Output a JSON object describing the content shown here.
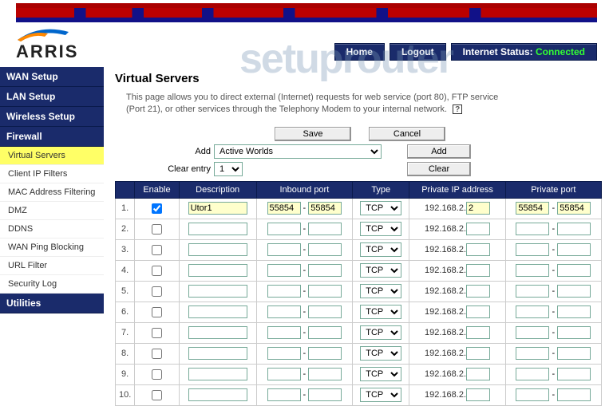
{
  "watermark": "setuprouter",
  "brand": "ARRIS",
  "nav": {
    "home": "Home",
    "logout": "Logout",
    "status_label": "Internet Status:",
    "status_value": "Connected"
  },
  "sidebar": {
    "sections": [
      {
        "title": "WAN Setup",
        "items": []
      },
      {
        "title": "LAN Setup",
        "items": []
      },
      {
        "title": "Wireless Setup",
        "items": []
      },
      {
        "title": "Firewall",
        "items": [
          "Virtual Servers",
          "Client IP Filters",
          "MAC Address Filtering",
          "DMZ",
          "DDNS",
          "WAN Ping Blocking",
          "URL Filter",
          "Security Log"
        ],
        "active_index": 0
      },
      {
        "title": "Utilities",
        "items": []
      }
    ]
  },
  "page": {
    "title": "Virtual Servers",
    "description": "This page allows you to direct external (Internet) requests for web service (port 80), FTP service (Port 21), or other services through the Telephony Modem to your internal network.",
    "help_icon": "?"
  },
  "controls": {
    "save": "Save",
    "cancel": "Cancel",
    "add_label": "Add",
    "add_select_value": "Active Worlds",
    "add_button": "Add",
    "clear_label": "Clear entry",
    "clear_select_value": "1",
    "clear_button": "Clear"
  },
  "table": {
    "headers": {
      "enable": "Enable",
      "description": "Description",
      "inbound": "Inbound port",
      "type": "Type",
      "private_ip": "Private IP address",
      "private_port": "Private port"
    },
    "ip_prefix": "192.168.2.",
    "type_option": "TCP",
    "rows": [
      {
        "n": "1.",
        "enabled": true,
        "desc": "Utor1",
        "in_from": "55854",
        "in_to": "55854",
        "ip": "2",
        "pp_from": "55854",
        "pp_to": "55854",
        "yellow": true
      },
      {
        "n": "2.",
        "enabled": false,
        "desc": "",
        "in_from": "",
        "in_to": "",
        "ip": "",
        "pp_from": "",
        "pp_to": "",
        "yellow": false
      },
      {
        "n": "3.",
        "enabled": false,
        "desc": "",
        "in_from": "",
        "in_to": "",
        "ip": "",
        "pp_from": "",
        "pp_to": "",
        "yellow": false
      },
      {
        "n": "4.",
        "enabled": false,
        "desc": "",
        "in_from": "",
        "in_to": "",
        "ip": "",
        "pp_from": "",
        "pp_to": "",
        "yellow": false
      },
      {
        "n": "5.",
        "enabled": false,
        "desc": "",
        "in_from": "",
        "in_to": "",
        "ip": "",
        "pp_from": "",
        "pp_to": "",
        "yellow": false
      },
      {
        "n": "6.",
        "enabled": false,
        "desc": "",
        "in_from": "",
        "in_to": "",
        "ip": "",
        "pp_from": "",
        "pp_to": "",
        "yellow": false
      },
      {
        "n": "7.",
        "enabled": false,
        "desc": "",
        "in_from": "",
        "in_to": "",
        "ip": "",
        "pp_from": "",
        "pp_to": "",
        "yellow": false
      },
      {
        "n": "8.",
        "enabled": false,
        "desc": "",
        "in_from": "",
        "in_to": "",
        "ip": "",
        "pp_from": "",
        "pp_to": "",
        "yellow": false
      },
      {
        "n": "9.",
        "enabled": false,
        "desc": "",
        "in_from": "",
        "in_to": "",
        "ip": "",
        "pp_from": "",
        "pp_to": "",
        "yellow": false
      },
      {
        "n": "10.",
        "enabled": false,
        "desc": "",
        "in_from": "",
        "in_to": "",
        "ip": "",
        "pp_from": "",
        "pp_to": "",
        "yellow": false
      }
    ]
  }
}
